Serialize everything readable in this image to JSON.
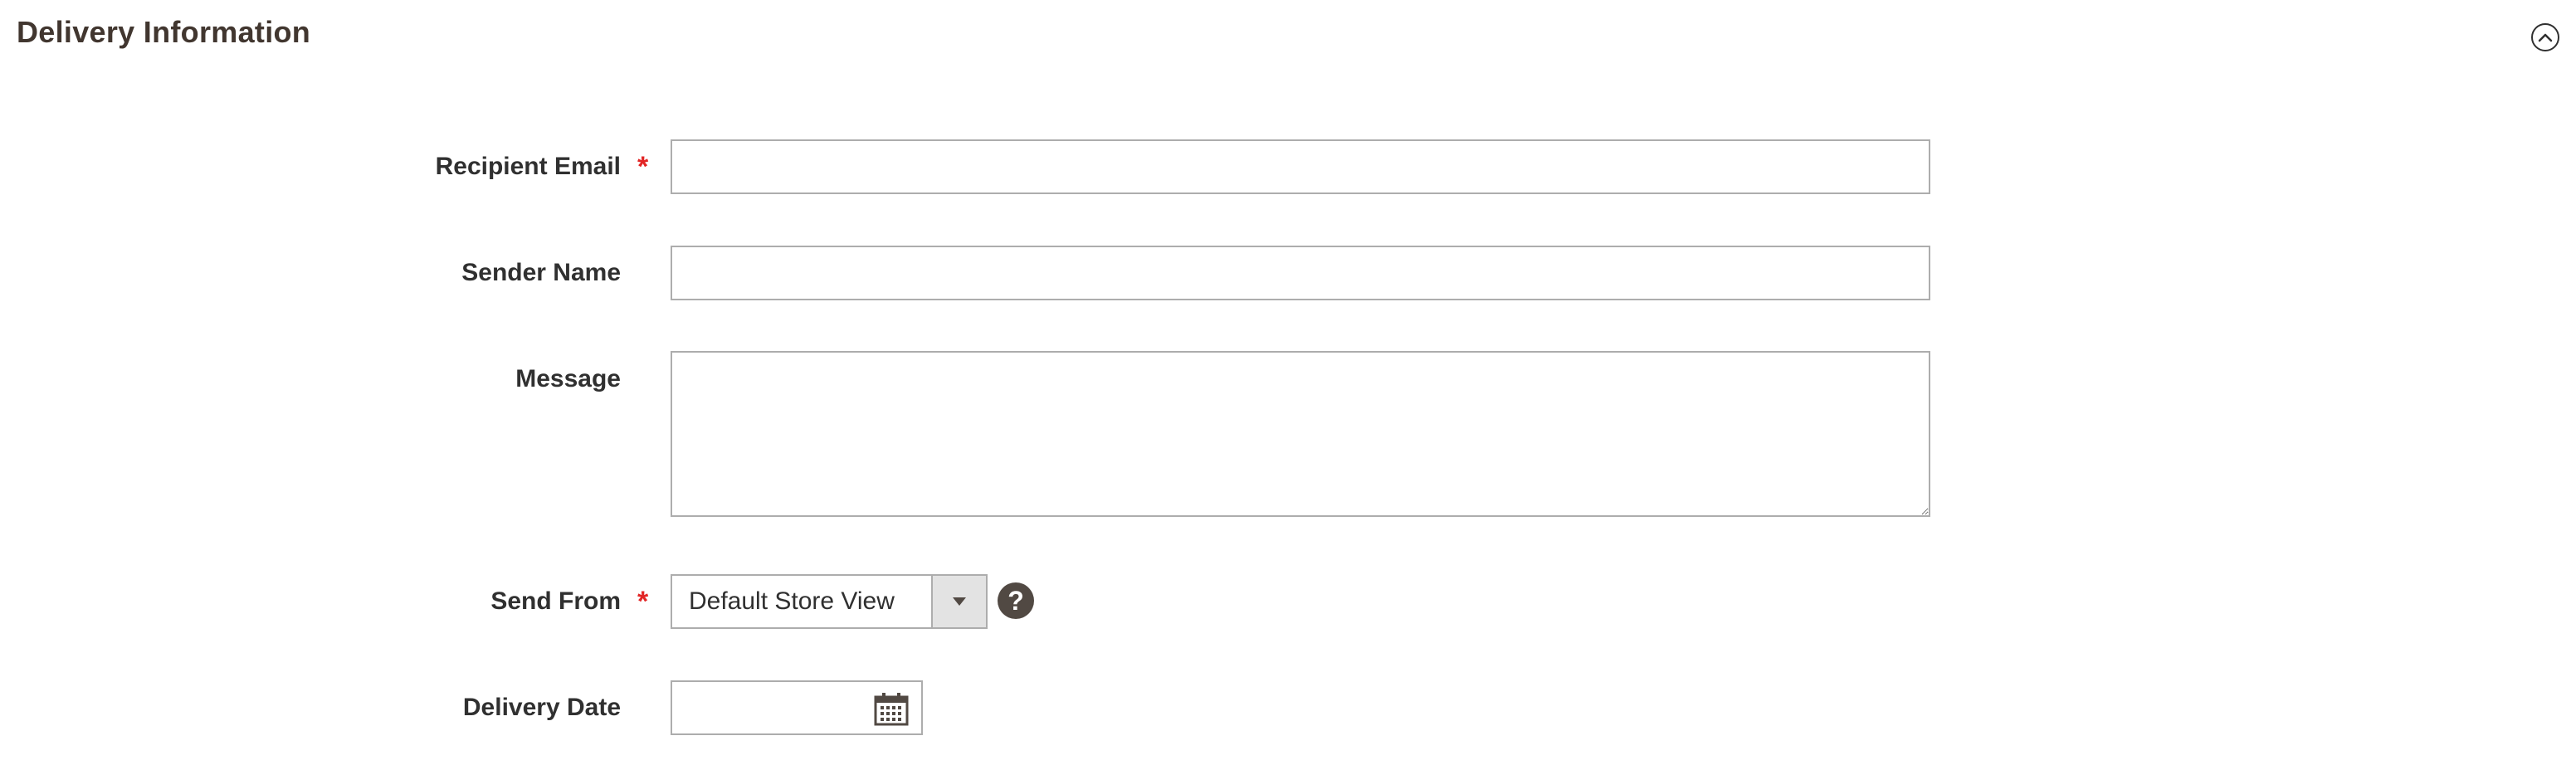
{
  "section": {
    "title": "Delivery Information",
    "collapse_icon": "chevron-up-circle-icon"
  },
  "fields": {
    "recipient_email": {
      "label": "Recipient Email",
      "required_mark": "*",
      "value": ""
    },
    "sender_name": {
      "label": "Sender Name",
      "value": ""
    },
    "message": {
      "label": "Message",
      "value": ""
    },
    "send_from": {
      "label": "Send From",
      "required_mark": "*",
      "selected": "Default Store View",
      "help_icon": "question-circle-icon",
      "help_glyph": "?"
    },
    "delivery_date": {
      "label": "Delivery Date",
      "value": "",
      "calendar_icon": "calendar-icon"
    }
  },
  "colors": {
    "required": "#e22626",
    "border": "#adadad",
    "help_bg": "#514943",
    "title": "#41362f"
  }
}
